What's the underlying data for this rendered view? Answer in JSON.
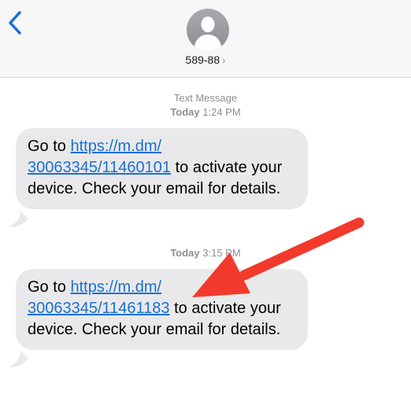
{
  "header": {
    "contact_name": "589-88",
    "chevron": "›"
  },
  "thread": {
    "service_label": "Text Message",
    "messages": [
      {
        "time_day": "Today",
        "time_clock": "1:24 PM",
        "prefix": "Go to ",
        "link_line1": "https://m.dm/",
        "link_line2": "30063345/11460101",
        "suffix": " to activate your device. Check your email for details."
      },
      {
        "time_day": "Today",
        "time_clock": "3:15 PM",
        "prefix": "Go to ",
        "link_line1": "https://m.dm/",
        "link_line2": "30063345/11461183",
        "suffix": " to activate your device. Check your email for details."
      }
    ]
  },
  "icons": {
    "back": "chevron-left-icon",
    "avatar": "person-silhouette-icon",
    "annotation": "red-arrow-icon"
  },
  "colors": {
    "accent": "#1a6fd6",
    "bubble": "#e9e9eb",
    "annotation_arrow": "#f23a2c"
  }
}
